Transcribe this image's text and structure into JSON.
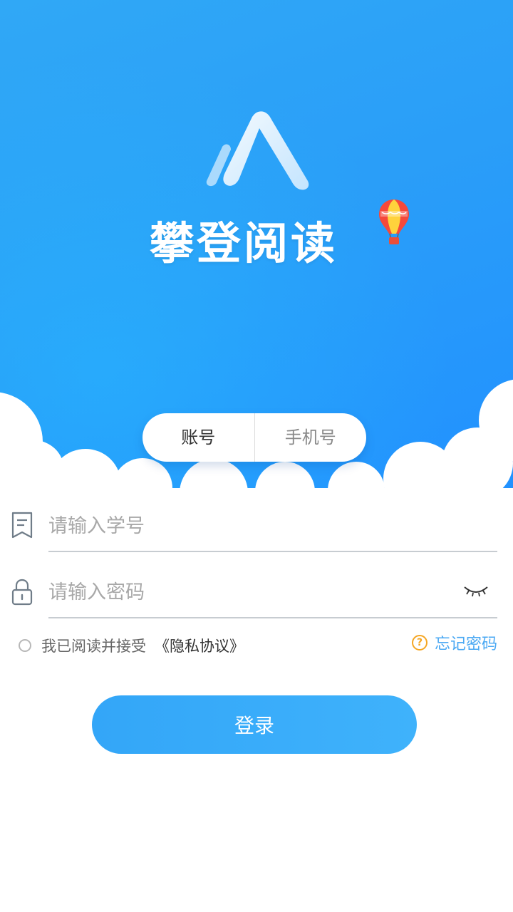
{
  "app": {
    "name": "攀登阅读"
  },
  "login_tabs": [
    {
      "label": "账号",
      "active": true
    },
    {
      "label": "手机号",
      "active": false
    }
  ],
  "form": {
    "student_id": {
      "placeholder": "请输入学号",
      "value": ""
    },
    "password": {
      "placeholder": "请输入密码",
      "value": ""
    }
  },
  "agreement": {
    "text": "我已阅读并接受",
    "link": "《隐私协议》",
    "checked": false
  },
  "forgot_password": {
    "label": "忘记密码",
    "icon": "question-circle-icon"
  },
  "login_button": {
    "label": "登录"
  },
  "colors": {
    "primary": "#2a9ef8",
    "accent": "#f5a623",
    "link": "#4aa8f3"
  }
}
